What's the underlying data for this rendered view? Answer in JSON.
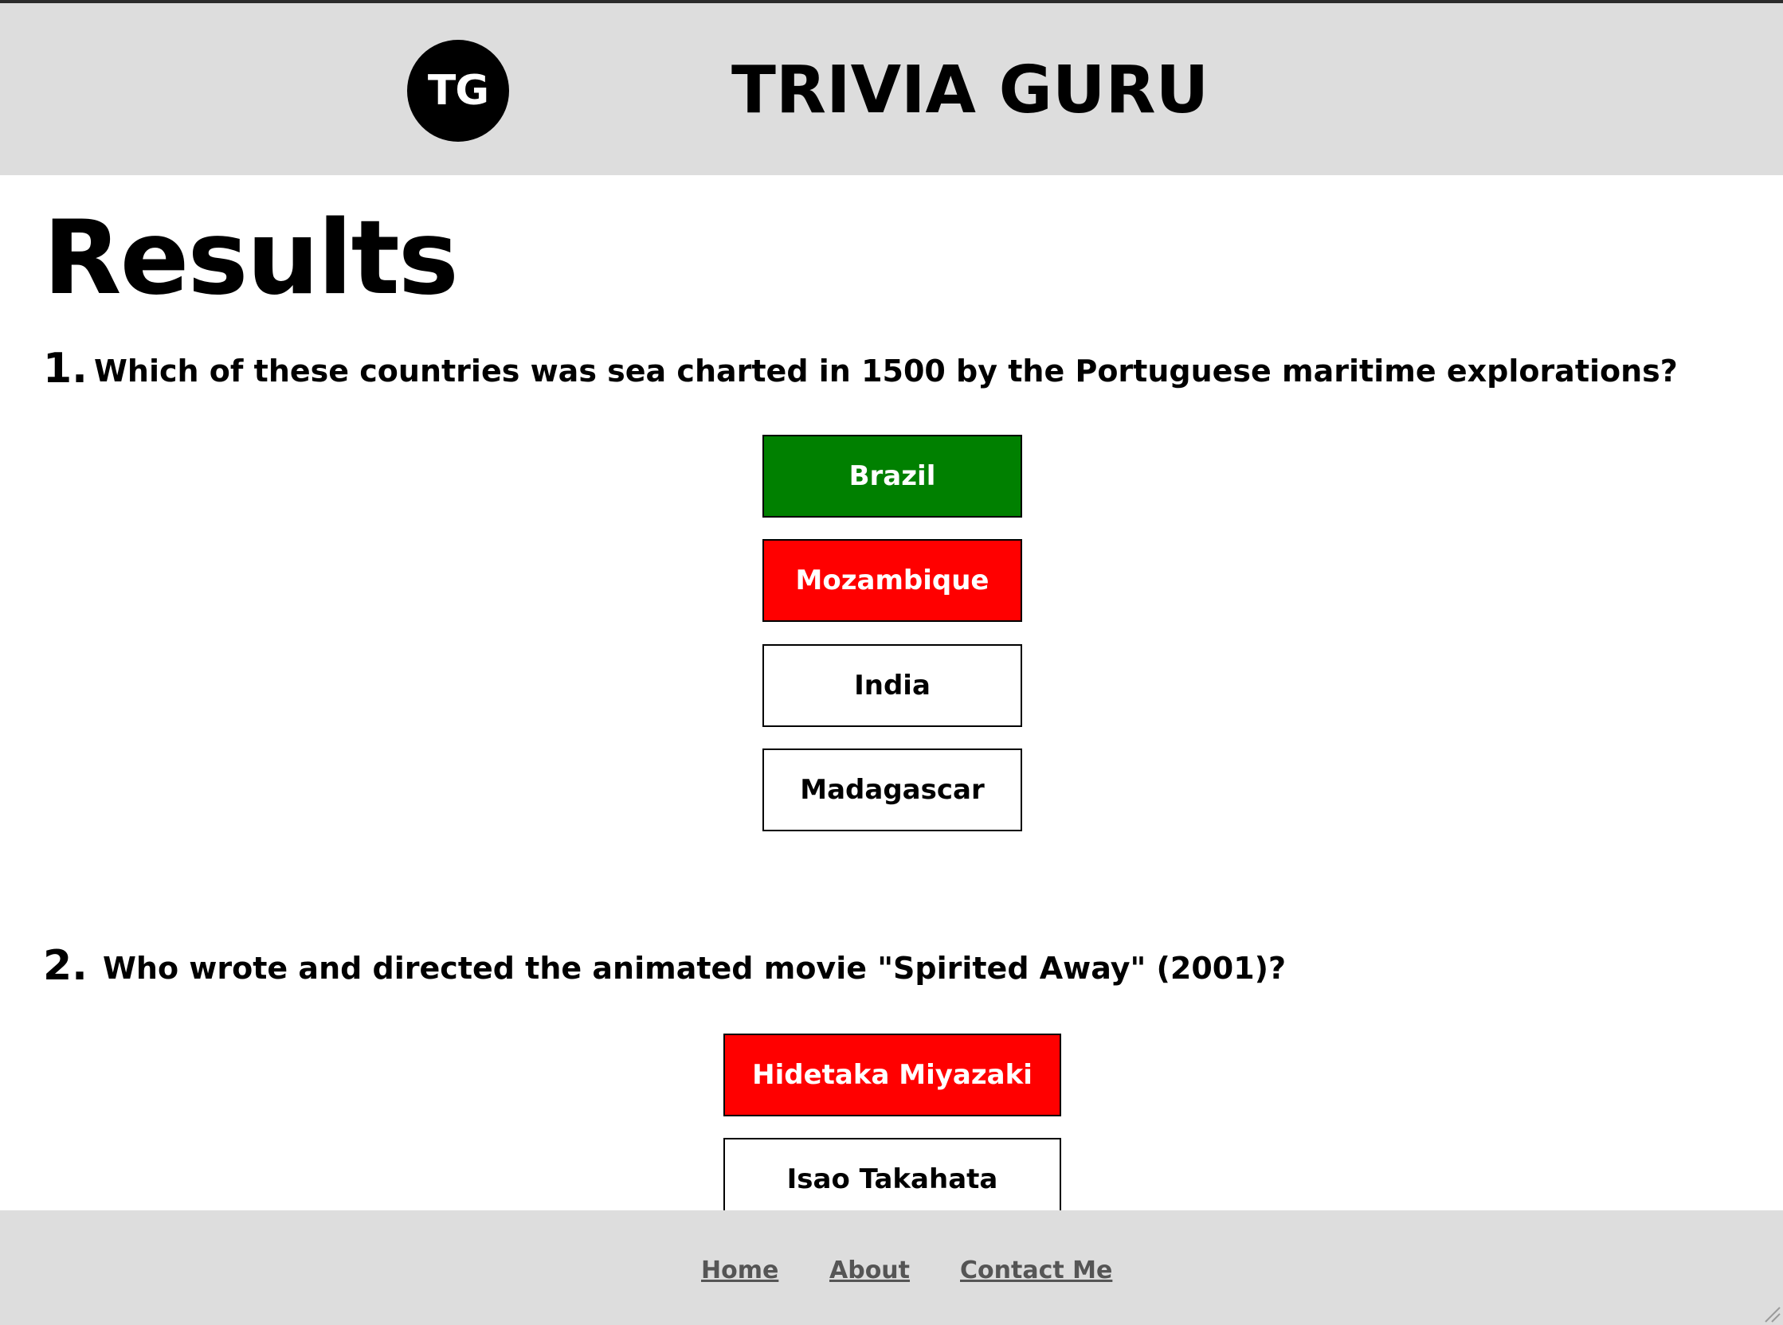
{
  "header": {
    "logo_text": "TG",
    "site_title": "TRIVIA GURU"
  },
  "main": {
    "heading": "Results",
    "questions": [
      {
        "number": "1.",
        "text": "Which of these countries was sea charted in 1500 by the Portuguese maritime explorations?",
        "answers": [
          {
            "label": "Brazil",
            "status": "correct"
          },
          {
            "label": "Mozambique",
            "status": "wrong"
          },
          {
            "label": "India",
            "status": "neutral"
          },
          {
            "label": "Madagascar",
            "status": "neutral"
          }
        ]
      },
      {
        "number": "2.",
        "text": "Who wrote and directed the animated movie \"Spirited Away\" (2001)?",
        "answers": [
          {
            "label": "Hidetaka Miyazaki",
            "status": "wrong"
          },
          {
            "label": "Isao Takahata",
            "status": "neutral"
          }
        ]
      }
    ]
  },
  "footer": {
    "links": [
      "Home",
      "About",
      "Contact Me"
    ]
  },
  "colors": {
    "correct": "#008000",
    "wrong": "#ff0000",
    "header_bg": "#dddddd",
    "footer_link": "#555555"
  }
}
